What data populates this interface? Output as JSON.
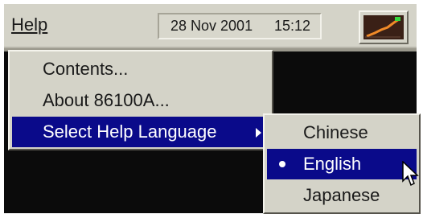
{
  "menubar": {
    "help_menu_label": "Help",
    "date": "28 Nov 2001",
    "time": "15:12"
  },
  "help_menu": {
    "items": [
      {
        "label": "Contents..."
      },
      {
        "label": "About 86100A..."
      },
      {
        "label": "Select Help Language",
        "has_submenu": true,
        "highlighted": true
      }
    ]
  },
  "language_submenu": {
    "items": [
      {
        "label": "Chinese",
        "selected": false
      },
      {
        "label": "English",
        "selected": true,
        "highlighted": true
      },
      {
        "label": "Japanese",
        "selected": false
      }
    ]
  },
  "colors": {
    "menu_bg": "#d4d3c8",
    "highlight": "#0a0a8a",
    "led": "#36d83e"
  }
}
